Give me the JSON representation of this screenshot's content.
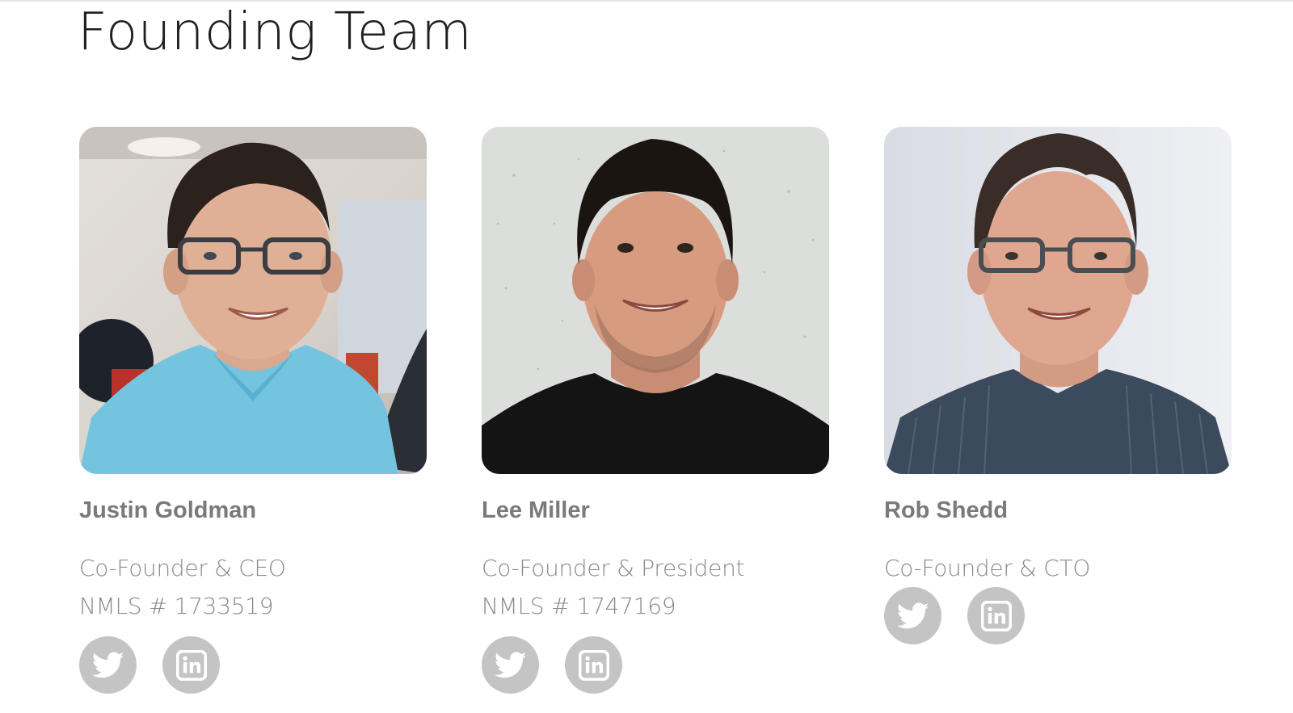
{
  "page": {
    "title": "Founding Team"
  },
  "team": [
    {
      "name": "Justin Goldman",
      "role": "Co-Founder & CEO",
      "nmls": "NMLS # 1733519",
      "photo_alt": "Justin Goldman",
      "social": [
        {
          "icon": "twitter-icon"
        },
        {
          "icon": "linkedin-icon"
        }
      ]
    },
    {
      "name": "Lee Miller",
      "role": "Co-Founder & President",
      "nmls": "NMLS # 1747169",
      "photo_alt": "Lee Miller",
      "social": [
        {
          "icon": "twitter-icon"
        },
        {
          "icon": "linkedin-icon"
        }
      ]
    },
    {
      "name": "Rob Shedd",
      "role": "Co-Founder & CTO",
      "nmls": "",
      "photo_alt": "Rob Shedd",
      "social": [
        {
          "icon": "twitter-icon"
        },
        {
          "icon": "linkedin-icon"
        }
      ]
    }
  ],
  "colors": {
    "title": "#1f1f1f",
    "name": "#7a7a7a",
    "meta": "#8a8a8a",
    "social_bg": "#c4c4c4",
    "social_fg": "#ffffff"
  }
}
